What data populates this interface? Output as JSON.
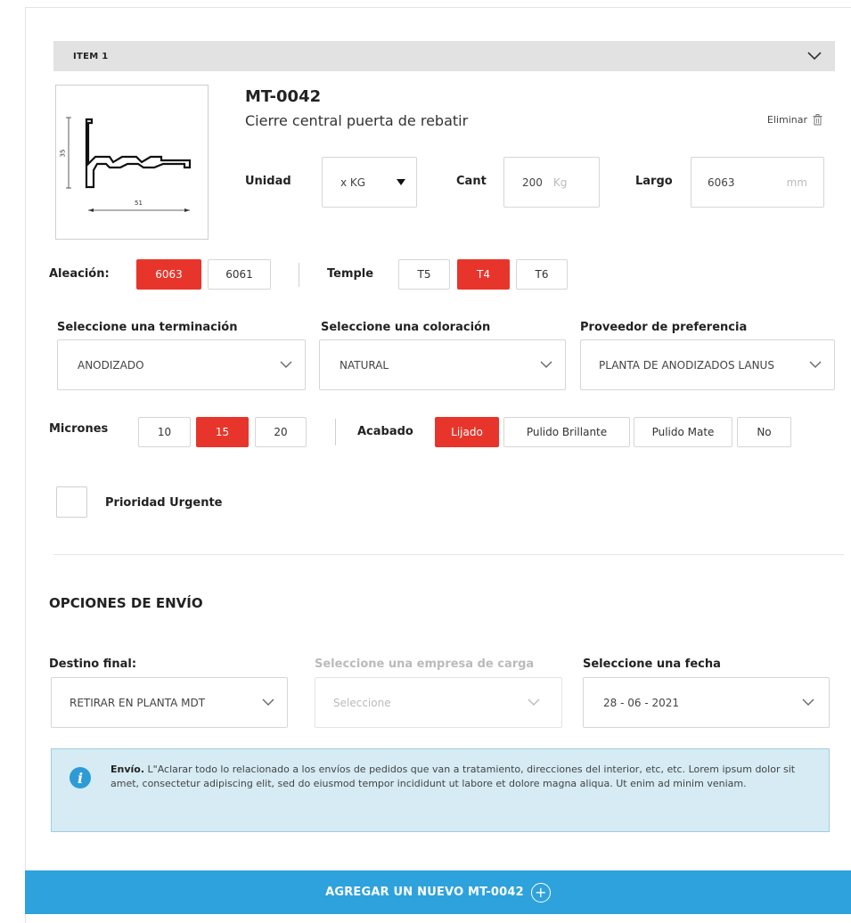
{
  "item": {
    "header": "ITEM 1",
    "code": "MT-0042",
    "description": "Cierre central puerta de rebatir",
    "delete_label": "Eliminar"
  },
  "drawing": {
    "height_dim": "35",
    "width_dim": "51"
  },
  "unidad": {
    "label": "Unidad",
    "value": "x KG"
  },
  "cant": {
    "label": "Cant",
    "value": "200",
    "unit": "Kg"
  },
  "largo": {
    "label": "Largo",
    "value": "6063",
    "unit": "mm"
  },
  "aleacion": {
    "label": "Aleación:",
    "options": [
      "6063",
      "6061"
    ],
    "selected": "6063"
  },
  "temple": {
    "label": "Temple",
    "options": [
      "T5",
      "T4",
      "T6"
    ],
    "selected": "T4"
  },
  "terminacion": {
    "label": "Seleccione una terminación",
    "value": "ANODIZADO"
  },
  "coloracion": {
    "label": "Seleccione una coloración",
    "value": "NATURAL"
  },
  "proveedor": {
    "label": "Proveedor de preferencia",
    "value": "PLANTA DE ANODIZADOS LANUS"
  },
  "micrones": {
    "label": "Micrones",
    "options": [
      "10",
      "15",
      "20"
    ],
    "selected": "15"
  },
  "acabado": {
    "label": "Acabado",
    "options": [
      "Lijado",
      "Pulido Brillante",
      "Pulido Mate",
      "No"
    ],
    "selected": "Lijado"
  },
  "prioridad": {
    "label": "Prioridad Urgente",
    "checked": false
  },
  "envio": {
    "title": "OPCIONES DE ENVÍO",
    "destino_label": "Destino final:",
    "destino_value": "RETIRAR EN PLANTA MDT",
    "empresa_label": "Seleccione una empresa de carga",
    "empresa_placeholder": "Seleccione",
    "fecha_label": "Seleccione una fecha",
    "fecha_value": "28 - 06 - 2021"
  },
  "info": {
    "title": "Envío.",
    "text": "L\"Aclarar todo lo relacionado a los envíos de pedidos que van a tratamiento, direcciones del interior, etc, etc. Lorem ipsum dolor sit amet, consectetur adipiscing elit, sed do eiusmod tempor incididunt ut labore et dolore magna aliqua. Ut enim ad minim veniam."
  },
  "cta_label": "AGREGAR UN NUEVO MT-0042",
  "colors": {
    "accent_red": "#e8352b",
    "accent_blue": "#2ea2dc",
    "info_bg": "#d6ebf3",
    "header_bg": "#e2e2e2"
  },
  "icons": [
    "chevron-down-icon",
    "trash-icon",
    "dropdown-arrow-icon",
    "info-icon",
    "plus-circle-icon"
  ]
}
